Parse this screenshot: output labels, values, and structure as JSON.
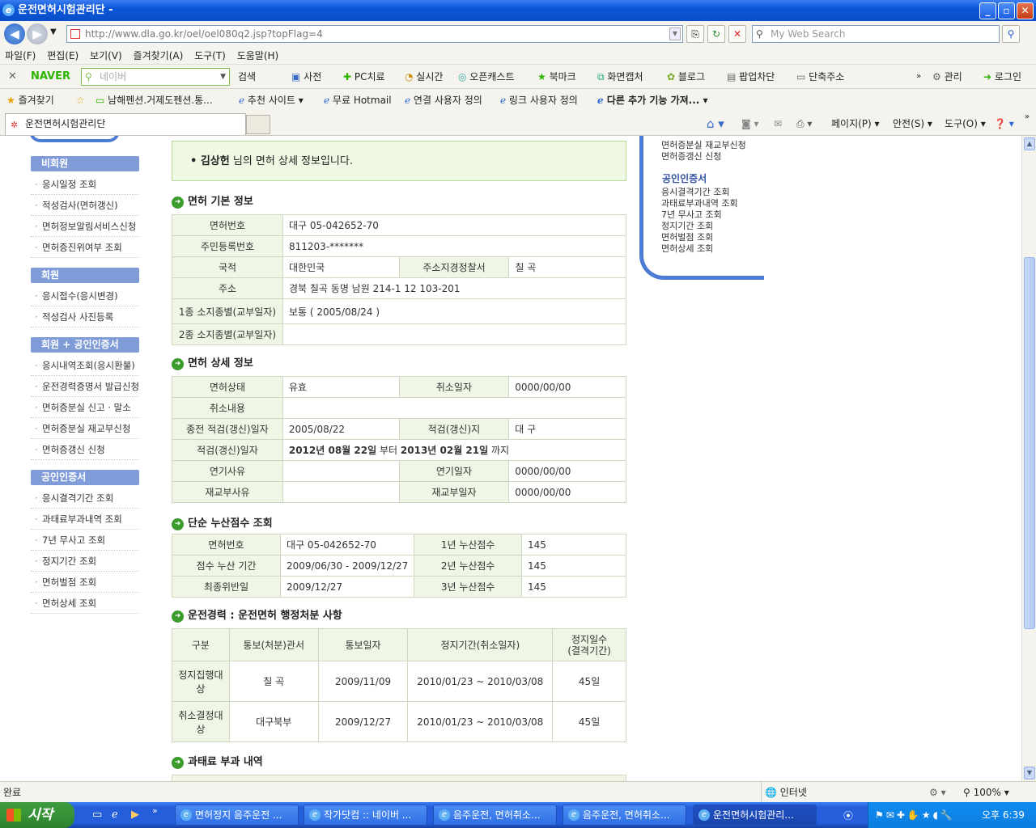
{
  "window": {
    "title": "운전면허시험관리단 -"
  },
  "address_bar": {
    "url": "http://www.dla.go.kr/oel/oel080q2.jsp?topFlag=4",
    "search_placeholder": "My Web Search"
  },
  "menu": [
    "파일(F)",
    "편집(E)",
    "보기(V)",
    "즐겨찾기(A)",
    "도구(T)",
    "도움말(H)"
  ],
  "naver_toolbar": {
    "logo": "NAVER",
    "search_placeholder": "네이버",
    "items": [
      "검색",
      "사전",
      "PC치료",
      "실시간",
      "오픈캐스트",
      "북마크",
      "화면캡처",
      "블로그",
      "팝업차단",
      "단축주소"
    ],
    "right_items": [
      "관리",
      "로그인"
    ]
  },
  "favorites_bar": {
    "label": "즐겨찾기",
    "items": [
      "남해펜션.거제도펜션.통...",
      "추천 사이트",
      "무료 Hotmail",
      "연결 사용자 정의",
      "링크 사용자 정의",
      "다른 추가 기능 가져..."
    ]
  },
  "tabs": [
    {
      "label": "운전면허시험관리단"
    }
  ],
  "command_bar": {
    "page": "페이지(P)",
    "safety": "안전(S)",
    "tools": "도구(O)"
  },
  "left_menu": {
    "sections": [
      {
        "title": "비회원",
        "items": [
          "응시일정 조회",
          "적성검사(면허갱신)",
          "면허정보알림서비스신청",
          "면허증진위여부 조회"
        ]
      },
      {
        "title": "회원",
        "items": [
          "응시접수(응시변경)",
          "적성검사 사진등록"
        ]
      },
      {
        "title": "회원 + 공인인증서",
        "items": [
          "응시내역조회(응시환불)",
          "운전경력증명서 발급신청",
          "면허증분실 신고 · 말소",
          "면허증분실 재교부신청",
          "면허증갱신 신청"
        ]
      },
      {
        "title": "공인인증서",
        "items": [
          "응시결격기간 조회",
          "과태료부과내역 조회",
          "7년 무사고 조회",
          "정지기간 조회",
          "면허벌점 조회",
          "면허상세 조회"
        ]
      }
    ]
  },
  "right_box": {
    "top_items": [
      "면허증분실 재교부신청",
      "면허증갱신 신청"
    ],
    "section_title": "공인인증서",
    "items": [
      "응시결격기간 조회",
      "과태료부과내역 조회",
      "7년 무사고 조회",
      "정지기간 조회",
      "면허벌점 조회",
      "면허상세 조회"
    ]
  },
  "notice": {
    "name": "김상헌",
    "text": "님의 면허 상세 정보입니다."
  },
  "basic_info": {
    "title": "면허 기본 정보",
    "license_no_label": "면허번호",
    "license_no": "대구 05-042652-70",
    "rrn_label": "주민등록번호",
    "rrn": "811203-*******",
    "nationality_label": "국적",
    "nationality": "대한민국",
    "police_label": "주소지경정찰서",
    "police": "칠 곡",
    "address_label": "주소",
    "address": "경북 칠곡 동명 남원 214-1 12 103-201",
    "type1_label": "1종 소지종별(교부일자)",
    "type1": "보통 ( 2005/08/24 )",
    "type2_label": "2종 소지종별(교부일자)",
    "type2": ""
  },
  "detail_info": {
    "title": "면허 상세 정보",
    "status_label": "면허상태",
    "status": "유효",
    "cancel_date_label": "취소일자",
    "cancel_date": "0000/00/00",
    "cancel_reason_label": "취소내용",
    "cancel_reason": "",
    "prev_date_label": "종전 적검(갱신)일자",
    "prev_date": "2005/08/22",
    "place_label": "적검(갱신)지",
    "place": "대 구",
    "renew_label": "적검(갱신)일자",
    "renew_from": "2012년 08월 22일",
    "renew_from_suffix": "부터",
    "renew_to": "2013년 02월 21일",
    "renew_to_suffix": "까지",
    "delay_reason_label": "연기사유",
    "delay_reason": "",
    "delay_date_label": "연기일자",
    "delay_date": "0000/00/00",
    "reissue_reason_label": "재교부사유",
    "reissue_reason": "",
    "reissue_date_label": "재교부일자",
    "reissue_date": "0000/00/00"
  },
  "points": {
    "title": "단순 누산점수 조회",
    "license_no_label": "면허번호",
    "license_no": "대구 05-042652-70",
    "y1_label": "1년 누산점수",
    "y1": "145",
    "period_label": "점수 누산 기간",
    "period": "2009/06/30 - 2009/12/27",
    "y2_label": "2년 누산점수",
    "y2": "145",
    "last_label": "최종위반일",
    "last": "2009/12/27",
    "y3_label": "3년 누산점수",
    "y3": "145"
  },
  "history": {
    "title": "운전경력 : 운전면허 행정처분 사항",
    "headers": [
      "구분",
      "통보(처분)관서",
      "통보일자",
      "정지기간(취소일자)",
      "정지일수\n(결격기간)"
    ],
    "rows": [
      [
        "정지집행대상",
        "칠 곡",
        "2009/11/09",
        "2010/01/23 ~ 2010/03/08",
        "45일"
      ],
      [
        "취소결정대상",
        "대구북부",
        "2009/12/27",
        "2010/01/23 ~ 2010/03/08",
        "45일"
      ]
    ]
  },
  "fines": {
    "title": "과태료 부과 내역"
  },
  "status_bar": {
    "status": "완료",
    "zone": "인터넷",
    "zoom": "100%"
  },
  "taskbar": {
    "start": "시작",
    "tasks": [
      "면허정지 음주운전 ...",
      "작가닷컴 :: 네이버 ...",
      "음주운전, 면허취소...",
      "음주운전, 면허취소...",
      "운전면허시험관리..."
    ],
    "clock": "오후 6:39"
  }
}
